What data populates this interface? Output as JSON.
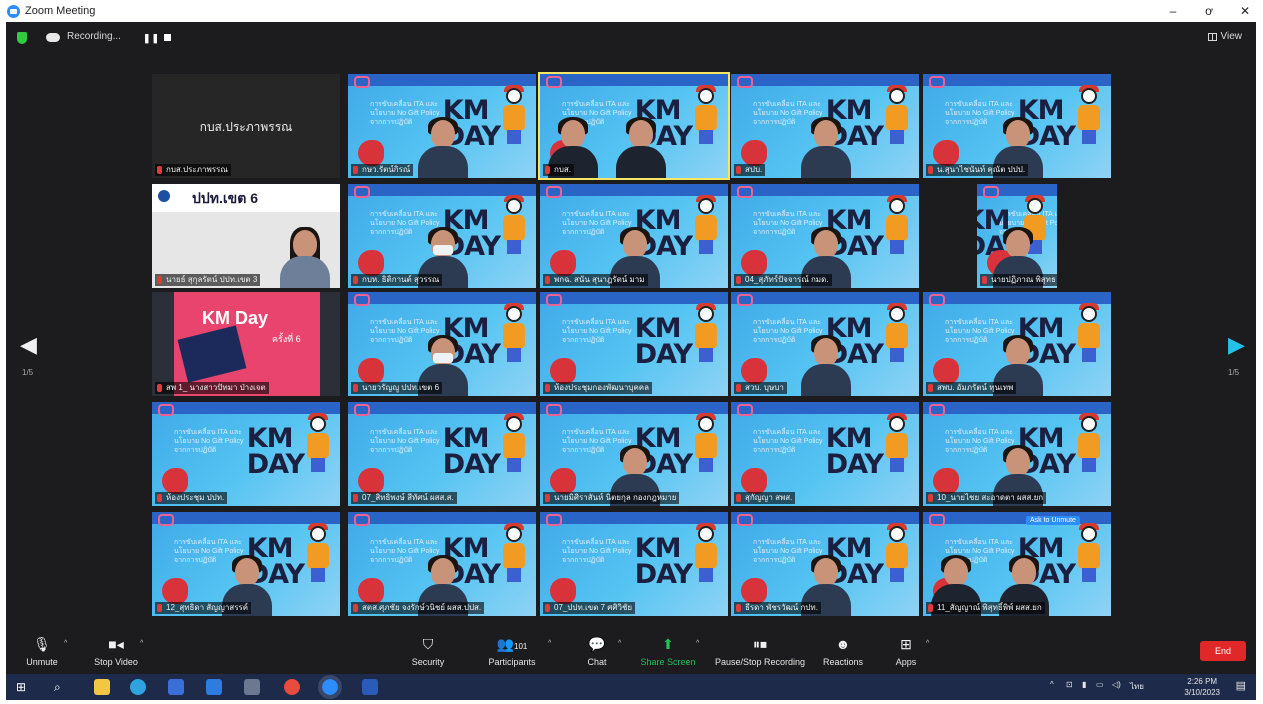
{
  "window": {
    "title": "Zoom Meeting",
    "minimize": "–",
    "maximize": "ơ",
    "close": "✕"
  },
  "topbar": {
    "recording_label": "Recording...",
    "pause_glyph": "❚❚",
    "view_label": "View"
  },
  "navigation": {
    "left_arrow": "◀",
    "right_arrow": "▶",
    "left_page": "1/5",
    "right_page": "1/5"
  },
  "ask_to_unmute": "Ask to Unmute",
  "participants": [
    {
      "kind": "name",
      "display_name": "กบส.ประภาพรรณ",
      "tag": "กบส.ประภาพรรณ"
    },
    {
      "kind": "poster-person",
      "tag": "กษว.รัตน์กิรณ์"
    },
    {
      "kind": "poster-two",
      "tag": "กบส.",
      "active": true
    },
    {
      "kind": "poster-person",
      "tag": "สปบ."
    },
    {
      "kind": "poster-person",
      "tag": "น.สุนาไชนันท์ คุณัต ปปป."
    },
    {
      "kind": "banner",
      "banner_text": "ปปท.เขต 6",
      "tag": "นายธ์ สุกุลรัตน์ ปปท.เขต 3"
    },
    {
      "kind": "poster-mask",
      "tag": "กบห. ธิติกานต์ สุวรรณ"
    },
    {
      "kind": "poster-person",
      "tag": "พกฉ. สนัน สุนาฎรัตน์ มาม"
    },
    {
      "kind": "poster-person",
      "tag": "04_สุภัทร์ปัจจารณ์ กมด."
    },
    {
      "kind": "poster-narrow",
      "tag": "นายปฏิภาณ พิสุทธ"
    },
    {
      "kind": "kmday",
      "kmday_title": "KM Day",
      "kmday_sub": "ครั้งที่ 6",
      "tag": "สพ 1_ นางสาวปัทมา ป่างเจต"
    },
    {
      "kind": "poster-mask",
      "tag": "นายวรัญญู ปปท.เขต 6"
    },
    {
      "kind": "poster",
      "tag": "ห้องประชุมกองพัฒนาบุคคล"
    },
    {
      "kind": "poster-person",
      "tag": "สวบ. บุษบา"
    },
    {
      "kind": "poster-person",
      "tag": "สพบ. อัมภรัตน์ ทุนเทพ"
    },
    {
      "kind": "poster",
      "tag": "ห้องประชุม ปปท."
    },
    {
      "kind": "poster",
      "tag": "07_สิทธิพงษ์ สีทัศน์ ผสส.ส."
    },
    {
      "kind": "poster-person",
      "tag": "นายมิศิราสันห์ นิตยกุล กองกฎหมาย"
    },
    {
      "kind": "poster",
      "tag": "สุกัญญา สพส."
    },
    {
      "kind": "poster-person",
      "tag": "10_นายไชย สะอาดตา ผสส.ยก"
    },
    {
      "kind": "poster-person",
      "tag": "12_สุทธิดา สัญญาสรรค์"
    },
    {
      "kind": "poster-person",
      "tag": "สตส.ศุภชัย จงรักษ์วนิชย์ ผสส.ปปส."
    },
    {
      "kind": "poster",
      "tag": "07_ปปท.เขต 7 ศศิวิชัย"
    },
    {
      "kind": "poster-office",
      "tag": "ธีรดา พัชรวัฒน์ กปท."
    },
    {
      "kind": "poster-two",
      "tag": "11_สัญญาณ์ พิสุทธิ์พิพ์ ผสส.ยก"
    }
  ],
  "poster": {
    "text": "การขับเคลื่อน ITA และนโยบาย No Gift Policy จากการปฏิบัติ",
    "km": "KM",
    "day": "DAY"
  },
  "toolbar": {
    "unmute": "Unmute",
    "stop_video": "Stop Video",
    "security": "Security",
    "participants": "Participants",
    "participants_count": "101",
    "chat": "Chat",
    "share_screen": "Share Screen",
    "pause_stop_recording": "Pause/Stop Recording",
    "reactions": "Reactions",
    "apps": "Apps",
    "end": "End"
  },
  "taskbar": {
    "time": "2:26 PM",
    "date": "3/10/2023",
    "lang": "ไทย"
  },
  "colors": {
    "zoom_blue": "#2d8cff",
    "share_green": "#20c05a",
    "end_red": "#e02828",
    "active_speaker": "#f5e663"
  }
}
